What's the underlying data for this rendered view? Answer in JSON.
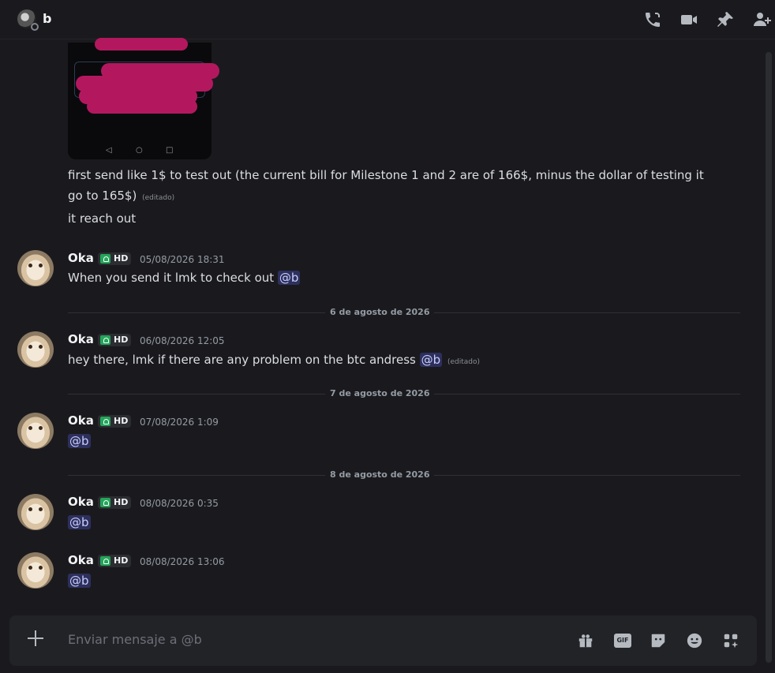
{
  "header": {
    "channel_name": "b",
    "icons": [
      "phone-call-icon",
      "video-camera-icon",
      "pin-icon",
      "add-friend-icon"
    ]
  },
  "previous_messages": {
    "line1": "first send like 1$ to test out (the current bill for Milestone 1 and 2 are of 166$, minus the dollar of testing it",
    "line2": "go to 165$)",
    "line2_edited": "(editado)",
    "line3": "it reach out"
  },
  "messages": [
    {
      "author": "Oka",
      "badge": "HD",
      "timestamp": "05/08/2026 18:31",
      "text": "When you send it lmk to check out",
      "mention": "@b",
      "edited": ""
    },
    {
      "author": "Oka",
      "badge": "HD",
      "timestamp": "06/08/2026 12:05",
      "text": "hey there, lmk if there are any problem on the btc andress",
      "mention": "@b",
      "edited": "(editado)"
    },
    {
      "author": "Oka",
      "badge": "HD",
      "timestamp": "07/08/2026 1:09",
      "text": "",
      "mention": "@b",
      "edited": ""
    },
    {
      "author": "Oka",
      "badge": "HD",
      "timestamp": "08/08/2026 0:35",
      "text": "",
      "mention": "@b",
      "edited": ""
    },
    {
      "author": "Oka",
      "badge": "HD",
      "timestamp": "08/08/2026 13:06",
      "text": "",
      "mention": "@b",
      "edited": ""
    }
  ],
  "dividers": [
    "6 de agosto de 2026",
    "7 de agosto de 2026",
    "8 de agosto de 2026"
  ],
  "composer": {
    "placeholder": "Enviar mensaje a @b",
    "gif_label": "GIF",
    "icons": [
      "add-attachment-icon",
      "gift-icon",
      "gif-icon",
      "sticker-icon",
      "emoji-icon",
      "apps-icon"
    ]
  },
  "colors": {
    "background": "#1a1a1e",
    "mention_bg": "#3a3f77",
    "badge_green": "#23a55a",
    "redaction": "#b3185f"
  }
}
